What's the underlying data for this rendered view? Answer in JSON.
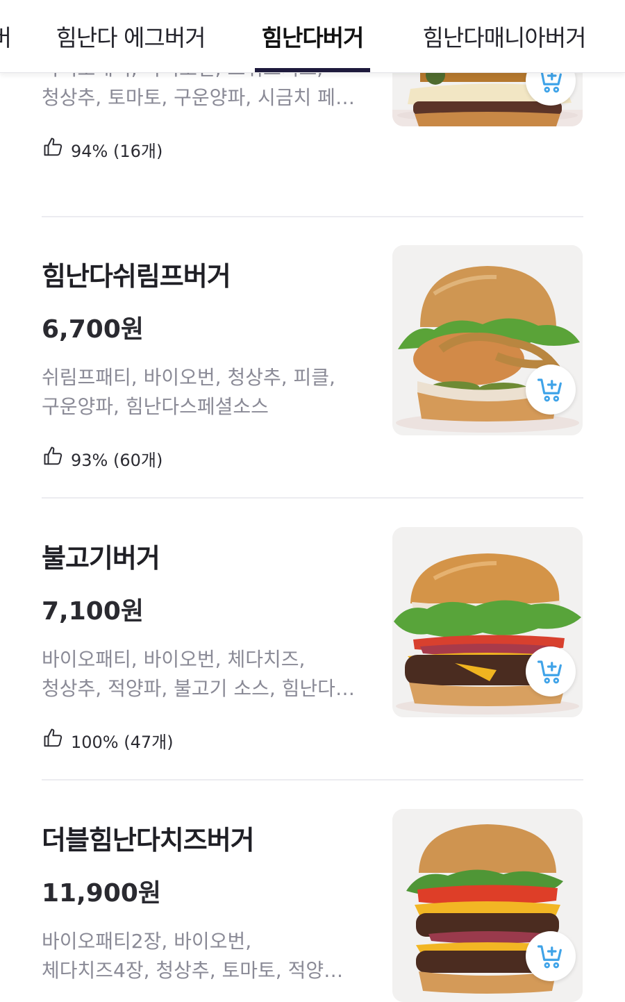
{
  "tabs": [
    {
      "label": "버"
    },
    {
      "label": "힘난다 에그버거"
    },
    {
      "label": "힘난다버거",
      "active": true
    },
    {
      "label": "힘난다매니아버거"
    }
  ],
  "items": [
    {
      "name": "",
      "price": "",
      "desc_lines": [
        "바이오패티, 바이오번, 스위스치즈,",
        "청상추, 토마토, 구운양파, 시금치 페…"
      ],
      "rating": "94% (16개)"
    },
    {
      "name": "힘난다쉬림프버거",
      "price": "6,700원",
      "desc_lines": [
        "쉬림프패티, 바이오번, 청상추, 피클,",
        "구운양파, 힘난다스페셜소스"
      ],
      "rating": "93% (60개)"
    },
    {
      "name": "불고기버거",
      "price": "7,100원",
      "desc_lines": [
        "바이오패티, 바이오번, 체다치즈,",
        "청상추, 적양파, 불고기 소스, 힘난다…"
      ],
      "rating": "100% (47개)"
    },
    {
      "name": "더블힘난다치즈버거",
      "price": "11,900원",
      "desc_lines": [
        "바이오패티2장, 바이오번,",
        "체다치즈4장, 청상추, 토마토, 적양…"
      ],
      "rating": ""
    }
  ],
  "colors": {
    "tab_indicator": "#1e1a3c",
    "cart_icon": "#3fa3e8",
    "description": "#8a8a96"
  },
  "icons": {
    "rating": "thumbs-up-icon",
    "cart": "cart-plus-icon"
  }
}
